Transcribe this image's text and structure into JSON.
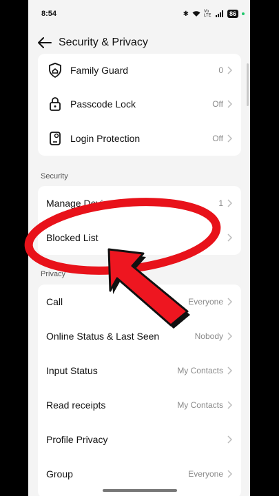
{
  "status_bar": {
    "time": "8:54",
    "battery": "86",
    "network": "Vo LTE"
  },
  "header": {
    "title": "Security & Privacy"
  },
  "top_group": [
    {
      "label": "Family Guard",
      "value": "0",
      "icon": "shield-home-icon"
    },
    {
      "label": "Passcode Lock",
      "value": "Off",
      "icon": "lock-icon"
    },
    {
      "label": "Login Protection",
      "value": "Off",
      "icon": "phone-lock-icon"
    }
  ],
  "security": {
    "title": "Security",
    "items": [
      {
        "label": "Manage Devices",
        "value": "1"
      },
      {
        "label": "Blocked List",
        "value": ""
      }
    ]
  },
  "privacy": {
    "title": "Privacy",
    "items": [
      {
        "label": "Call",
        "value": "Everyone"
      },
      {
        "label": "Online Status & Last Seen",
        "value": "Nobody"
      },
      {
        "label": "Input Status",
        "value": "My Contacts"
      },
      {
        "label": "Read receipts",
        "value": "My Contacts"
      },
      {
        "label": "Profile Privacy",
        "value": ""
      },
      {
        "label": "Group",
        "value": "Everyone"
      }
    ]
  },
  "annotation": {
    "shape": "red-ellipse-and-arrow",
    "color": "#ff1414"
  }
}
